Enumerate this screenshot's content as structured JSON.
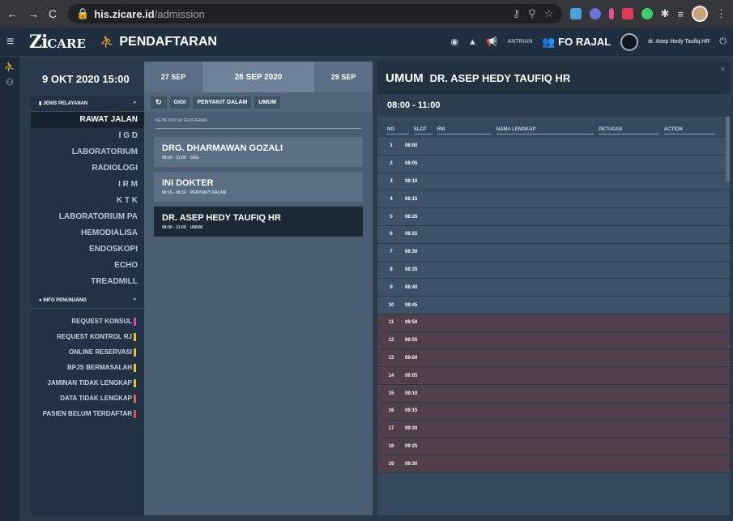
{
  "browser": {
    "url_host": "his.zicare.id",
    "url_path": "/admission"
  },
  "header": {
    "logo_main": "Zi",
    "logo_sub": "CARE",
    "module_title": "PENDAFTARAN",
    "antrian_label": "ANTRIAN",
    "fo_label": "FO RAJAL",
    "user_name": "dr. Asep Hedy Taufiq HR"
  },
  "left": {
    "date": "9 OKT 2020 15:00",
    "jenis_label": "JENIS PELAYANAN",
    "menu": [
      "RAWAT JALAN",
      "I G D",
      "LABORATORIUM",
      "RADIOLOGI",
      "I R M",
      "K T K",
      "LABORATORIUM PA",
      "HEMODIALISA",
      "ENDOSKOPI",
      "ECHO",
      "TREADMILL"
    ],
    "info_label": "INFO PENUNJANG",
    "info": [
      {
        "label": "REQUEST KONSUL",
        "color": "#d84fb0"
      },
      {
        "label": "REQUEST KONTROL RJ",
        "color": "#f0c419"
      },
      {
        "label": "ONLINE RESERVASI",
        "color": "#f0c419"
      },
      {
        "label": "BPJS BERMASALAH",
        "color": "#f0c419"
      },
      {
        "label": "JAMINAN TIDAK LENGKAP",
        "color": "#f0c419"
      },
      {
        "label": "DATA TIDAK LENGKAP",
        "color": "#e8623a"
      },
      {
        "label": "PASIEN BELUM TERDAFTAR",
        "color": "#e84a5f"
      }
    ]
  },
  "mid": {
    "tab_prev": "27 SEP",
    "tab_current": "28 SEP 2020",
    "tab_next": "29 SEP",
    "filters": [
      "GIGI",
      "PENYAKIT DALAM",
      "UMUM"
    ],
    "search_placeholder": "KETIK UNTUK PENCARIAN",
    "doctors": [
      {
        "name": "DRG. DHARMAWAN GOZALI",
        "time": "08:00 - 11:00",
        "spec": "GIGI"
      },
      {
        "name": "INI DOKTER",
        "time": "06:15 - 08:15",
        "spec": "PENYAKIT DALAM"
      },
      {
        "name": "DR. ASEP HEDY TAUFIQ HR",
        "time": "08:00 - 11:00",
        "spec": "UMUM"
      }
    ]
  },
  "right": {
    "category": "UMUM",
    "doctor": "DR. ASEP HEDY TAUFIQ HR",
    "time_range": "08:00 - 11:00",
    "columns": [
      "NO",
      "SLOT",
      "RM",
      "NAMA LENGKAP",
      "PETUGAS",
      "ACTION"
    ],
    "slots": [
      "08:00",
      "08:05",
      "08:10",
      "08:15",
      "08:20",
      "08:25",
      "08:30",
      "08:35",
      "08:40",
      "08:45",
      "08:50",
      "08:55",
      "09:00",
      "09:05",
      "09:10",
      "09:15",
      "09:20",
      "09:25",
      "09:30"
    ]
  }
}
